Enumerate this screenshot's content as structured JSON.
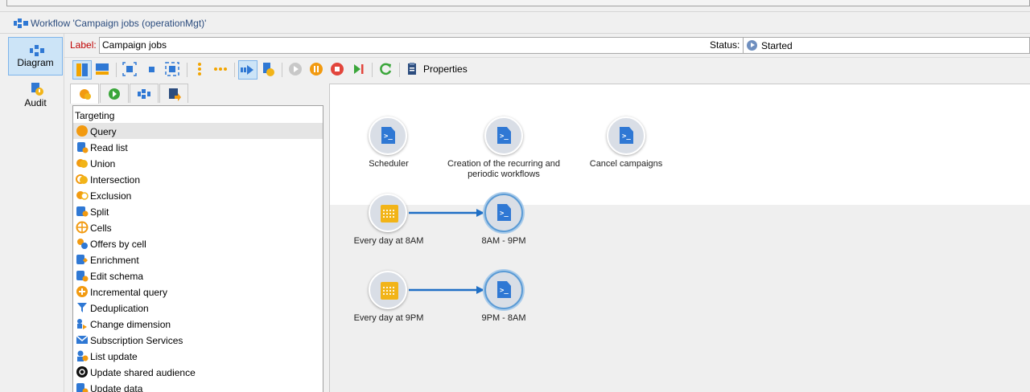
{
  "window": {
    "title": "Workflow 'Campaign jobs (operationMgt)'"
  },
  "nav": {
    "items": [
      {
        "label": "Diagram",
        "icon": "diagram-icon",
        "active": true
      },
      {
        "label": "Audit",
        "icon": "audit-icon",
        "active": false
      }
    ]
  },
  "form": {
    "label_caption": "Label:",
    "label_value": "Campaign jobs",
    "status_caption": "Status:",
    "status_value": "Started"
  },
  "toolbar": {
    "properties_label": "Properties",
    "buttons": [
      "layout-vertical-icon",
      "layout-horizontal-icon",
      "select-all-icon",
      "square-icon",
      "fit-icon",
      "align-vertical-icon",
      "align-horizontal-icon",
      "transitions-icon",
      "edit-icon",
      "start-icon",
      "pause-icon",
      "stop-icon",
      "step-icon",
      "refresh-icon",
      "properties-icon"
    ]
  },
  "palette": {
    "tabs": [
      "targeting-tab-icon",
      "flow-control-tab-icon",
      "actions-tab-icon",
      "events-tab-icon"
    ],
    "header": "Targeting",
    "items": [
      {
        "label": "Query",
        "selected": true
      },
      {
        "label": "Read list"
      },
      {
        "label": "Union"
      },
      {
        "label": "Intersection"
      },
      {
        "label": "Exclusion"
      },
      {
        "label": "Split"
      },
      {
        "label": "Cells"
      },
      {
        "label": "Offers by cell"
      },
      {
        "label": "Enrichment"
      },
      {
        "label": "Edit schema"
      },
      {
        "label": "Incremental query"
      },
      {
        "label": "Deduplication"
      },
      {
        "label": "Change dimension"
      },
      {
        "label": "Subscription Services"
      },
      {
        "label": "List update"
      },
      {
        "label": "Update shared audience"
      },
      {
        "label": "Update data"
      }
    ]
  },
  "diagram": {
    "nodes": [
      {
        "label": "Scheduler",
        "type": "script"
      },
      {
        "label": "Creation of the recurring and periodic workflows",
        "type": "script"
      },
      {
        "label": "Cancel campaigns",
        "type": "script"
      },
      {
        "label": "Every day at 8AM",
        "type": "scheduler"
      },
      {
        "label": "8AM - 9PM",
        "type": "script"
      },
      {
        "label": "Every day at 9PM",
        "type": "scheduler"
      },
      {
        "label": "9PM - 8AM",
        "type": "script"
      }
    ],
    "colors": {
      "accent": "#2f78d4",
      "scheduler": "#f2b418",
      "arrow": "#1f6fc5"
    }
  }
}
